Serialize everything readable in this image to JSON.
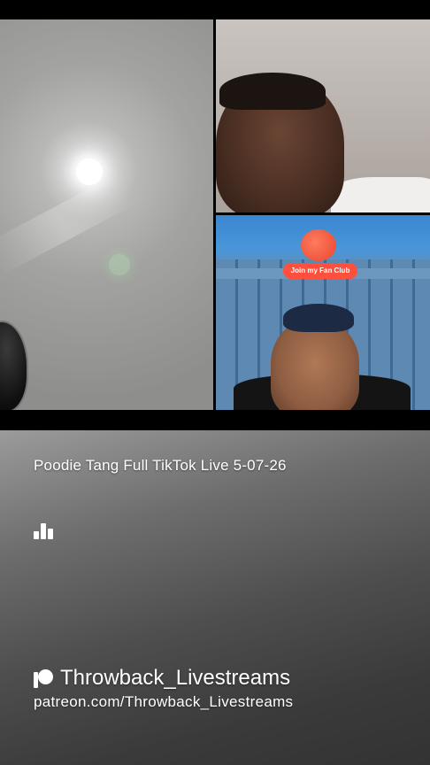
{
  "video": {
    "title": "Poodie Tang Full TikTok Live 5-07-26",
    "fan_club_label": "Join my Fan Club"
  },
  "icons": {
    "stats": "bar-chart-icon",
    "brand": "patreon-icon"
  },
  "brand": {
    "name": "Throwback_Livestreams",
    "url": "patreon.com/Throwback_Livestreams"
  }
}
